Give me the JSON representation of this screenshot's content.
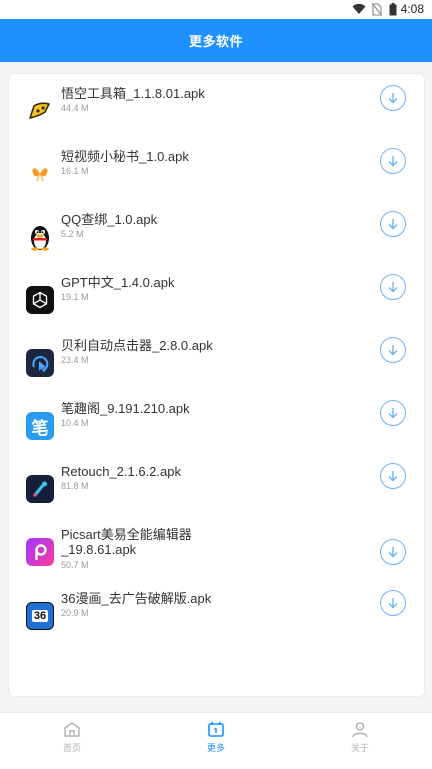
{
  "status_bar": {
    "time": "4:08"
  },
  "header": {
    "title": "更多软件"
  },
  "apps": [
    {
      "name": "悟空工具箱_1.1.8.01.apk",
      "size": "44.4 M",
      "icon": "wukong-toolbox-icon"
    },
    {
      "name": "短视频小秘书_1.0.apk",
      "size": "16.1 M",
      "icon": "butterfly-icon"
    },
    {
      "name": "QQ查绑_1.0.apk",
      "size": "5.2 M",
      "icon": "qq-penguin-icon"
    },
    {
      "name": "GPT中文_1.4.0.apk",
      "size": "19.1 M",
      "icon": "openai-icon"
    },
    {
      "name": "贝利自动点击器_2.8.0.apk",
      "size": "23.4 M",
      "icon": "auto-clicker-icon"
    },
    {
      "name": "笔趣阁_9.191.210.apk",
      "size": "10.4 M",
      "icon": "biquge-icon"
    },
    {
      "name": "Retouch_2.1.6.2.apk",
      "size": "81.8 M",
      "icon": "retouch-icon"
    },
    {
      "name": "Picsart美易全能编辑器\n_19.8.61.apk",
      "size": "50.7 M",
      "icon": "picsart-icon"
    },
    {
      "name": "36漫画_去广告破解版.apk",
      "size": "20.9 M",
      "icon": "manhua36-icon"
    }
  ],
  "bottom_nav": [
    {
      "label": "首页",
      "icon": "home-icon",
      "active": false
    },
    {
      "label": "更多",
      "icon": "more-icon",
      "active": true
    },
    {
      "label": "关于",
      "icon": "user-icon",
      "active": false
    }
  ],
  "icon_labels": {
    "biquge": "笔",
    "manhua36": "36"
  },
  "colors": {
    "primary": "#1e90ff",
    "download_ring": "#6fb3f2",
    "nav_inactive": "#b0b0b0"
  }
}
